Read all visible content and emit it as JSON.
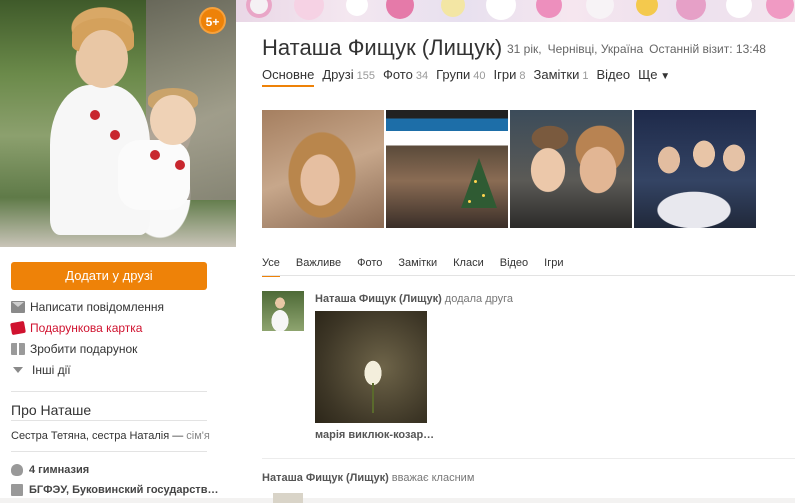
{
  "profile": {
    "name": "Наташа Фищук (Лищук)",
    "age": "31 рік,",
    "location": "Чернівці, Україна",
    "last_visit": "Останній візит: 13:48",
    "badge": "5+"
  },
  "left": {
    "add_friend": "Додати у друзі",
    "actions": {
      "message": "Написати повідомлення",
      "card": "Подарункова картка",
      "gift": "Зробити подарунок",
      "other": "Інші дії"
    },
    "about_title": "Про Наташе",
    "family_text": "Сестра Тетяна, сестра Наталія —",
    "family_suffix": "сім'я",
    "education": [
      "4 гимназия",
      "БГФЭУ, Буковинский государств…"
    ]
  },
  "nav": [
    {
      "label": "Основне",
      "count": ""
    },
    {
      "label": "Друзі",
      "count": "155"
    },
    {
      "label": "Фото",
      "count": "34"
    },
    {
      "label": "Групи",
      "count": "40"
    },
    {
      "label": "Ігри",
      "count": "8"
    },
    {
      "label": "Замітки",
      "count": "1"
    },
    {
      "label": "Відео",
      "count": ""
    },
    {
      "label": "Ще",
      "count": ""
    }
  ],
  "tabs": [
    "Усе",
    "Важливе",
    "Фото",
    "Замітки",
    "Класи",
    "Відео",
    "Ігри"
  ],
  "feed": [
    {
      "author": "Наташа Фищук (Лищук)",
      "action": "додала друга",
      "caption": "марія виклюк-козар…"
    },
    {
      "author": "Наташа Фищук (Лищук)",
      "action": "вважає класним"
    }
  ],
  "colors": {
    "accent": "#ee8208",
    "red_link": "#d0122f"
  }
}
